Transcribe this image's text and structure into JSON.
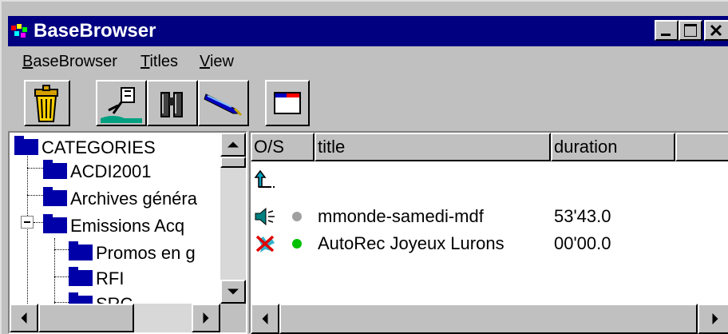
{
  "window": {
    "title": "BaseBrowser",
    "controls": [
      "minimize-icon",
      "maximize-icon",
      "close-icon"
    ]
  },
  "menu": [
    {
      "label": "BaseBrowser",
      "accel": "B"
    },
    {
      "label": "Titles",
      "accel": "T"
    },
    {
      "label": "View",
      "accel": "V"
    }
  ],
  "toolbar": {
    "buttons": [
      {
        "name": "trash-button",
        "icon": "trash-can-icon"
      },
      {
        "name": "record-button",
        "icon": "microphone-icon"
      },
      {
        "name": "search-button",
        "icon": "binoculars-icon"
      },
      {
        "name": "edit-button",
        "icon": "pen-icon"
      },
      {
        "name": "window-button",
        "icon": "window-icon"
      }
    ]
  },
  "tree": {
    "items": [
      {
        "label": "CATEGORIES",
        "level": 0
      },
      {
        "label": "ACDI2001",
        "level": 1
      },
      {
        "label": "Archives généra",
        "level": 1
      },
      {
        "label": "Emissions Acq",
        "level": 1,
        "expanded": true
      },
      {
        "label": "Promos en g",
        "level": 2
      },
      {
        "label": "RFI",
        "level": 2
      },
      {
        "label": "SRC",
        "level": 2
      }
    ]
  },
  "list": {
    "columns": [
      "O/S",
      "title",
      "duration",
      ""
    ],
    "rows": [
      {
        "type": "parent",
        "title": "",
        "duration": ""
      },
      {
        "type": "audio",
        "status_color": "#a0a0a0",
        "title": "mmonde-samedi-mdf",
        "duration": "53'43.0"
      },
      {
        "type": "error",
        "status_color": "#00c000",
        "title": "AutoRec Joyeux Lurons",
        "duration": "00'00.0"
      }
    ]
  },
  "colors": {
    "titlebar": "#000080",
    "folder": "#0000a8",
    "face": "#c0c0c0"
  }
}
